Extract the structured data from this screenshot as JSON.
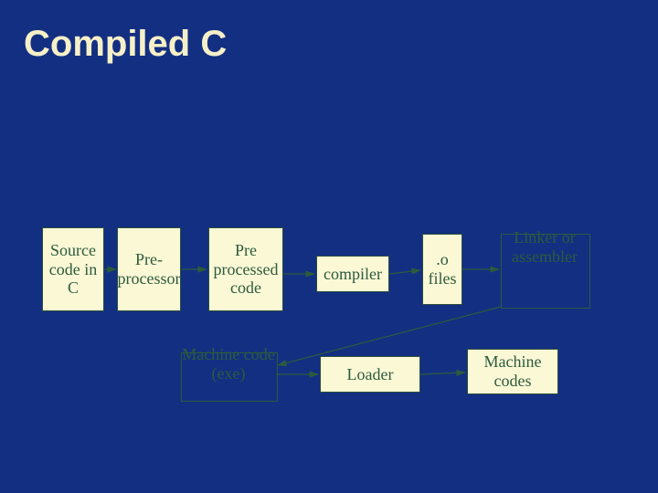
{
  "title": "Compiled C",
  "nodes": {
    "source": {
      "label": "Source code in C"
    },
    "preproc": {
      "label": "Pre-processor"
    },
    "preprocessed": {
      "label": "Pre processed code"
    },
    "compiler": {
      "label": "compiler"
    },
    "ofiles": {
      "label": ".o files"
    },
    "linker": {
      "label": "Linker or assembler"
    },
    "machine_exe": {
      "label": "Machine code (exe)"
    },
    "loader": {
      "label": "Loader"
    },
    "machine_codes": {
      "label": "Machine codes"
    }
  },
  "colors": {
    "background": "#132f82",
    "box_fill": "#fbf8d6",
    "text": "#2c5b3c",
    "title": "#f6f0c8"
  }
}
